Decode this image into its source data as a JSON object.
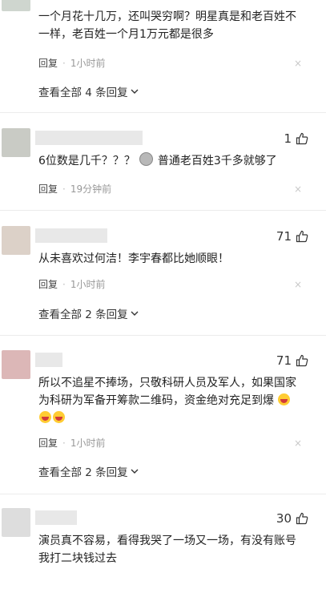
{
  "comments": [
    {
      "text_lines": [
        "一个月花十几万，还叫哭穷啊？明星真是和老百姓不",
        "一样，老百姓一个月1万元都是很多"
      ],
      "reply": "回复",
      "time": "1小时前",
      "more": "查看全部 4 条回复"
    },
    {
      "avatar_color": "#c9cbc5",
      "likes": "1",
      "text_a": "6位数是几千？？？",
      "text_b": "普通老百姓3千多就够了",
      "emoji": "smug-emoji",
      "reply": "回复",
      "time": "19分钟前"
    },
    {
      "avatar_color": "#dcd1c8",
      "likes": "71",
      "text_lines": [
        "从未喜欢过何洁！李宇春都比她顺眼！"
      ],
      "reply": "回复",
      "time": "1小时前",
      "more": "查看全部 2 条回复"
    },
    {
      "avatar_color": "#dcb7b7",
      "likes": "71",
      "text_lines": [
        "所以不追星不捧场，只敬科研人员及军人，如果国家",
        "为科研为军备开筹款二维码，资金绝对充足到爆"
      ],
      "emoji": "laughing-emoji",
      "reply": "回复",
      "time": "1小时前",
      "more": "查看全部 2 条回复"
    },
    {
      "avatar_color": "#dddddd",
      "likes": "30",
      "text_lines": [
        "演员真不容易，看得我哭了一场又一场，有没有账号",
        "我打二块钱过去"
      ]
    }
  ],
  "icons": {
    "like": "thumbs-up-icon",
    "close": "close-icon",
    "expand": "chevron-down-icon"
  },
  "close_glyph": "×"
}
